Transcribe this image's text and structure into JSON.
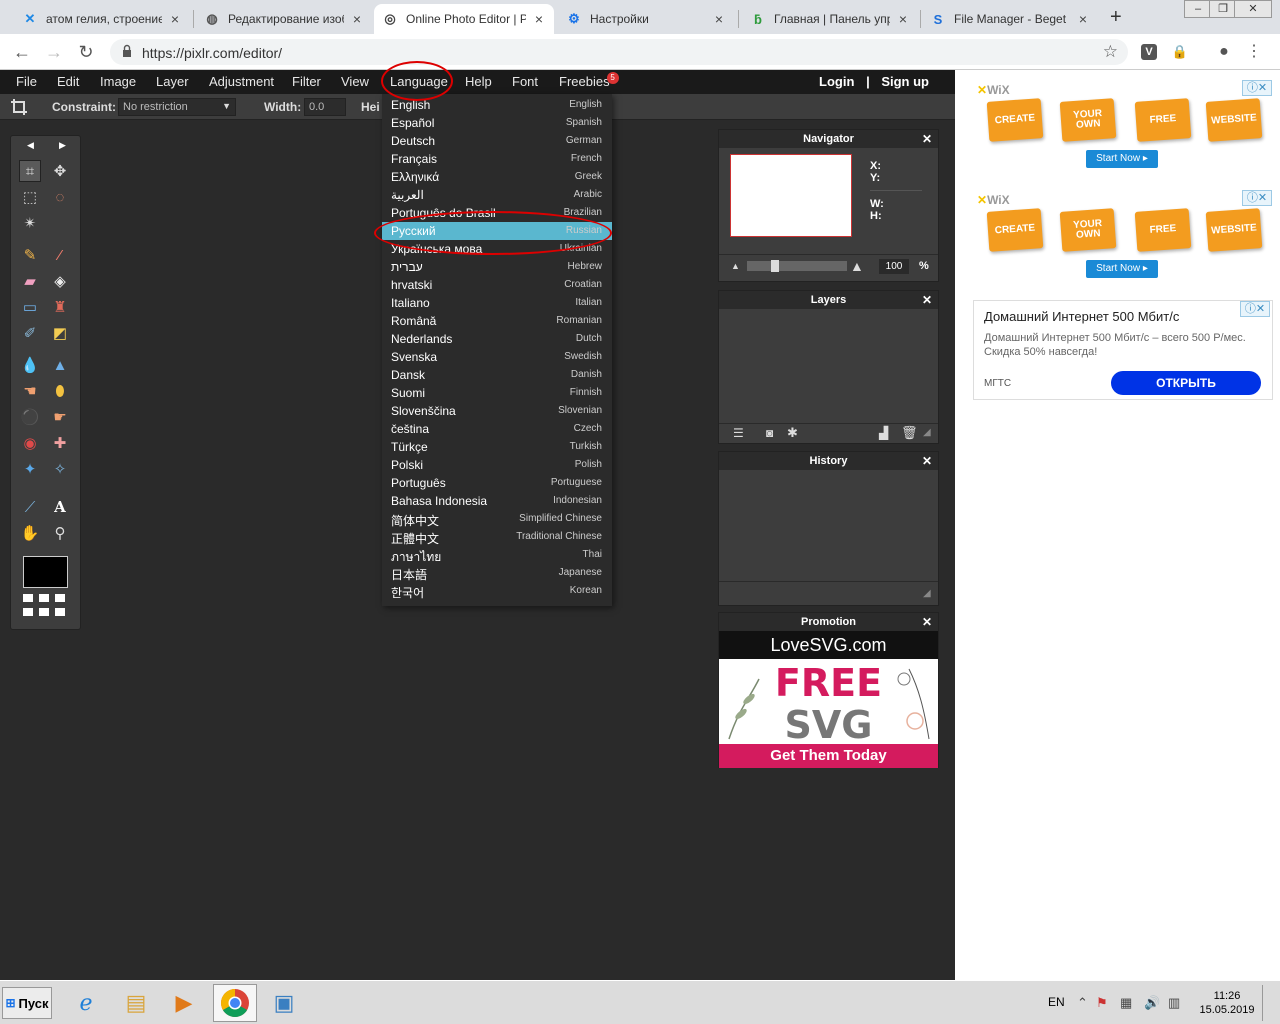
{
  "browser": {
    "tabs": [
      {
        "icon": "x-icon",
        "title": "атом гелия, строение я"
      },
      {
        "icon": "globe-icon",
        "title": "Редактирование изобр"
      },
      {
        "icon": "pixlr-icon",
        "title": "Online Photo Editor | Pi"
      },
      {
        "icon": "gear-icon",
        "title": "Настройки"
      },
      {
        "icon": "beget-icon",
        "title": "Главная | Панель упра"
      },
      {
        "icon": "filemanager-icon",
        "title": "File Manager - Beget"
      }
    ],
    "url": "https://pixlr.com/editor/"
  },
  "menubar": {
    "items": [
      "File",
      "Edit",
      "Image",
      "Layer",
      "Adjustment",
      "Filter",
      "View",
      "Language",
      "Help",
      "Font",
      "Freebies"
    ],
    "freebies_badge": "5",
    "login": "Login",
    "separator": "|",
    "signup": "Sign up"
  },
  "options": {
    "constraint_label": "Constraint:",
    "constraint_value": "No restriction",
    "width_label": "Width:",
    "width_value": "0.0",
    "height_label": "Hei"
  },
  "language_menu": [
    {
      "native": "English",
      "english": "English"
    },
    {
      "native": "Español",
      "english": "Spanish"
    },
    {
      "native": "Deutsch",
      "english": "German"
    },
    {
      "native": "Français",
      "english": "French"
    },
    {
      "native": "Ελληνικά",
      "english": "Greek"
    },
    {
      "native": "العربية",
      "english": "Arabic"
    },
    {
      "native": "Português do Brasil",
      "english": "Brazilian"
    },
    {
      "native": "Русский",
      "english": "Russian",
      "active": true
    },
    {
      "native": "Українська мова",
      "english": "Ukrainian"
    },
    {
      "native": "עברית",
      "english": "Hebrew"
    },
    {
      "native": "hrvatski",
      "english": "Croatian"
    },
    {
      "native": "Italiano",
      "english": "Italian"
    },
    {
      "native": "Română",
      "english": "Romanian"
    },
    {
      "native": "Nederlands",
      "english": "Dutch"
    },
    {
      "native": "Svenska",
      "english": "Swedish"
    },
    {
      "native": "Dansk",
      "english": "Danish"
    },
    {
      "native": "Suomi",
      "english": "Finnish"
    },
    {
      "native": "Slovenščina",
      "english": "Slovenian"
    },
    {
      "native": "čeština",
      "english": "Czech"
    },
    {
      "native": "Türkçe",
      "english": "Turkish"
    },
    {
      "native": "Polski",
      "english": "Polish"
    },
    {
      "native": "Português",
      "english": "Portuguese"
    },
    {
      "native": "Bahasa Indonesia",
      "english": "Indonesian"
    },
    {
      "native": "简体中文",
      "english": "Simplified Chinese"
    },
    {
      "native": "正體中文",
      "english": "Traditional Chinese"
    },
    {
      "native": "ภาษาไทย",
      "english": "Thai"
    },
    {
      "native": "日本語",
      "english": "Japanese"
    },
    {
      "native": "한국어",
      "english": "Korean"
    }
  ],
  "panels": {
    "navigator": {
      "title": "Navigator",
      "x_label": "X:",
      "y_label": "Y:",
      "w_label": "W:",
      "h_label": "H:",
      "zoom": "100",
      "zoom_unit": "%"
    },
    "layers": {
      "title": "Layers"
    },
    "history": {
      "title": "History"
    },
    "promotion": {
      "title": "Promotion",
      "logo": "LoveSVG.com",
      "line1": "FREE",
      "line2": "SVG",
      "cta": "Get Them Today"
    }
  },
  "ads": {
    "wix": {
      "logo": "WiX",
      "tags": [
        "CREATE",
        "YOUR OWN",
        "FREE",
        "WEBSITE"
      ],
      "button": "Start Now ▸"
    },
    "mgts": {
      "title": "Домашний Интернет 500 Мбит/с",
      "text": "Домашний Интернет 500 Мбит/с – всего 500 Р/мес. Скидка 50% навсегда!",
      "brand": "МГТС",
      "button": "ОТКРЫТЬ"
    }
  },
  "taskbar": {
    "start": "Пуск",
    "lang": "EN",
    "time": "11:26",
    "date": "15.05.2019"
  },
  "colors": {
    "accent": "#5ab7cf",
    "menubar": "#1a1a1a",
    "panel": "#3d3d3d",
    "workspace": "#2a2a2a"
  }
}
